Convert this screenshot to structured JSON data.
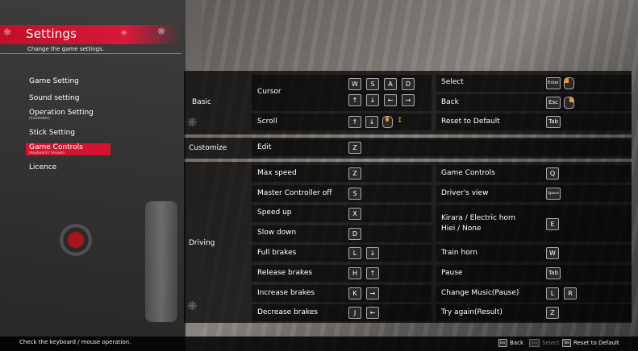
{
  "header": {
    "title": "Settings",
    "subtitle": "Change the game settings."
  },
  "menu": [
    {
      "label": "Game Setting"
    },
    {
      "label": "Sound setting"
    },
    {
      "label": "Operation Setting",
      "sub": "(Controller)"
    },
    {
      "label": "Stick Setting"
    },
    {
      "label": "Game Controls",
      "sub": "(keyboard / mouse)",
      "active": true
    },
    {
      "label": "Licence"
    }
  ],
  "sections": {
    "basic": "Basic",
    "customize": "Customize",
    "driving": "Driving"
  },
  "basic": {
    "cursor": {
      "label": "Cursor",
      "keys_top": [
        "W",
        "S",
        "A",
        "D"
      ],
      "keys_bottom": [
        "↑",
        "↓",
        "←",
        "→"
      ]
    },
    "scroll": {
      "label": "Scroll",
      "keys": [
        "↑",
        "↓"
      ]
    },
    "select": {
      "label": "Select",
      "key": "Enter"
    },
    "back": {
      "label": "Back",
      "key": "Esc"
    },
    "reset": {
      "label": "Reset to Default",
      "key": "Tab"
    }
  },
  "customize": {
    "edit": {
      "label": "Edit",
      "key": "Z"
    }
  },
  "driving_left": [
    {
      "label": "Max speed",
      "keys": [
        "Z"
      ]
    },
    {
      "label": "Master Controller off",
      "keys": [
        "S"
      ]
    },
    {
      "label": "Speed up",
      "keys": [
        "X"
      ]
    },
    {
      "label": "Slow down",
      "keys": [
        "D"
      ]
    },
    {
      "label": "Full brakes",
      "keys": [
        "L",
        "↓"
      ]
    },
    {
      "label": "Release brakes",
      "keys": [
        "H",
        "↑"
      ]
    },
    {
      "label": "Increase brakes",
      "keys": [
        "K",
        "→"
      ]
    },
    {
      "label": "Decrease brakes",
      "keys": [
        "J",
        "←"
      ]
    }
  ],
  "driving_right": {
    "game_controls": {
      "label": "Game Controls",
      "key": "Q"
    },
    "drivers_view": {
      "label": "Driver's view",
      "key": "Space"
    },
    "horn1": {
      "label": "Kirara / Electric horn",
      "label2": "Hiei / None",
      "key": "E"
    },
    "train_horn": {
      "label": "Train horn",
      "key": "W"
    },
    "pause": {
      "label": "Pause",
      "key": "Tab"
    },
    "change_music": {
      "label": "Change Music(Pause)",
      "keys": [
        "L",
        "R"
      ]
    },
    "try_again": {
      "label": "Try again(Result)",
      "key": "Z"
    }
  },
  "footer": {
    "hint": "Check the keyboard / mouse operation.",
    "back_key": "Esc",
    "back": "Back",
    "select_key": "Enter",
    "select": "Select",
    "reset_key": "Tab",
    "reset": "Reset to Default"
  }
}
